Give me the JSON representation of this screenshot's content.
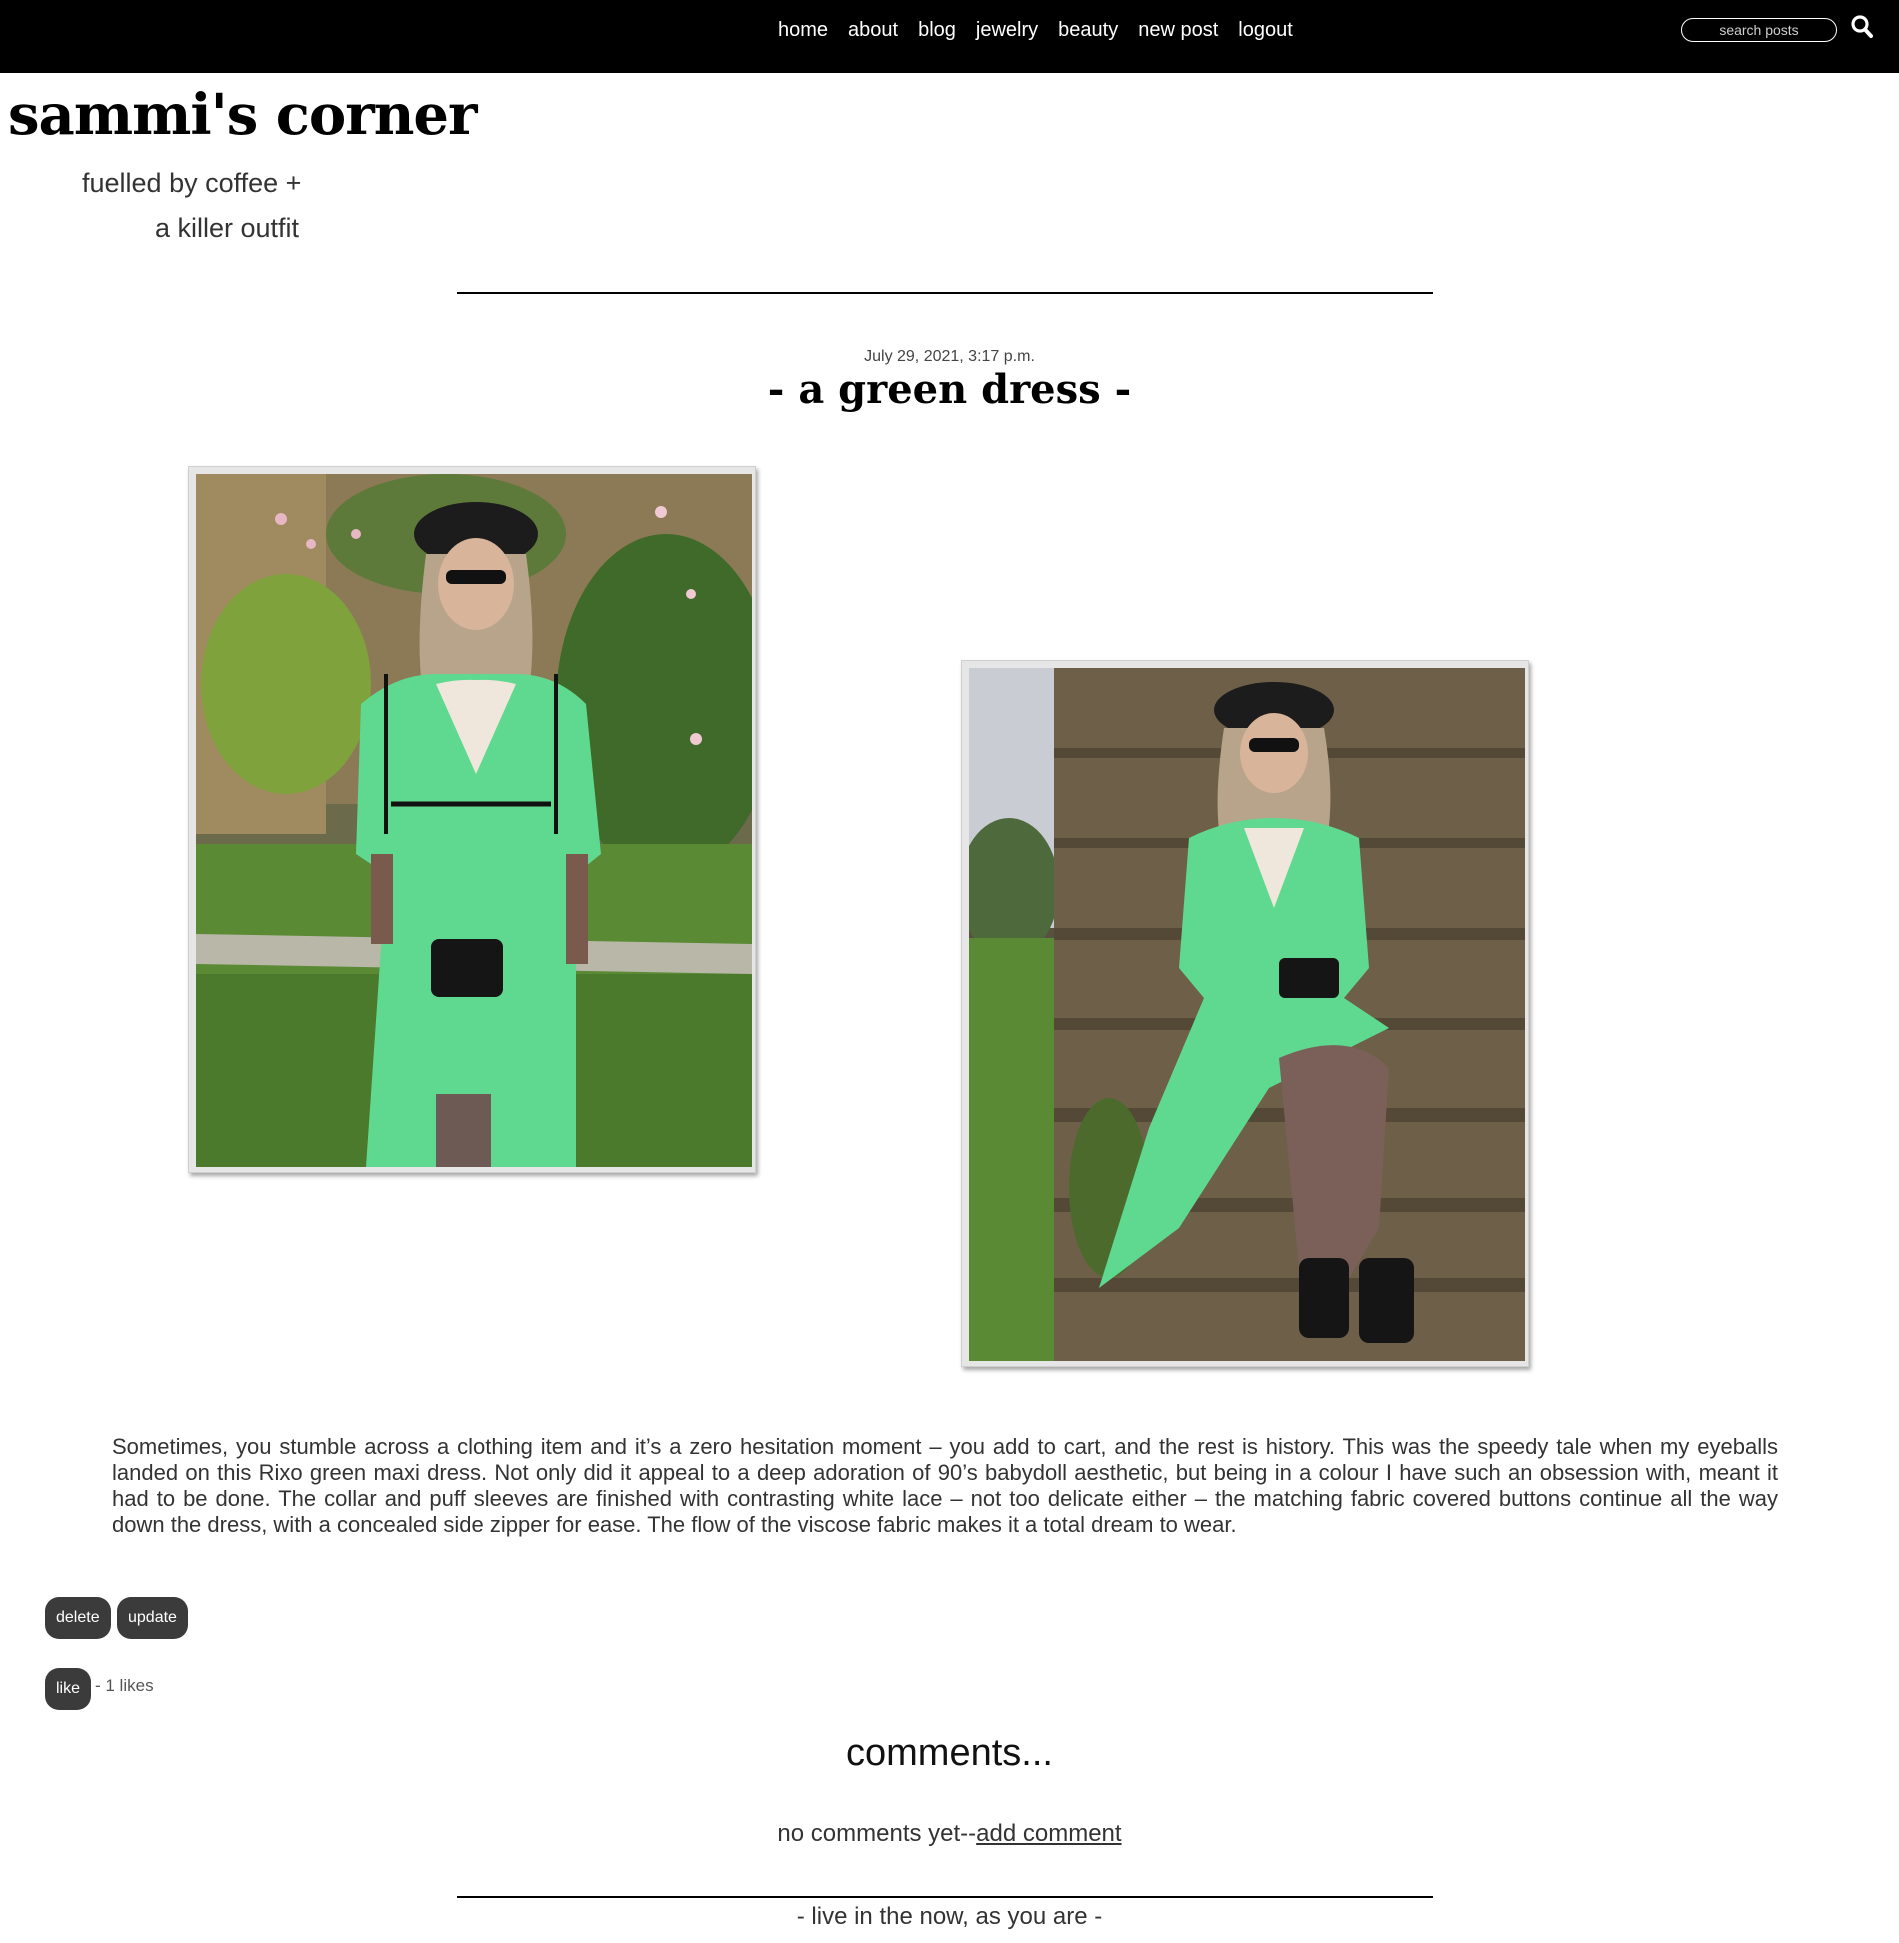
{
  "nav": {
    "links": [
      "home",
      "about",
      "blog",
      "jewelry",
      "beauty",
      "new post",
      "logout"
    ],
    "search_placeholder": "search posts",
    "search_icon": "search-icon"
  },
  "header": {
    "title": "sammi's corner",
    "tagline_line1": "fuelled by coffee +",
    "tagline_line2": "a killer outfit"
  },
  "post": {
    "date": "July 29, 2021, 3:17 p.m.",
    "title": "- a green dress -",
    "images": [
      {
        "name": "post-photo-standing",
        "depicts": "woman in green satin maxi dress standing on lawn"
      },
      {
        "name": "post-photo-sitting",
        "depicts": "woman in green satin maxi dress sitting on stone steps"
      }
    ],
    "body": "Sometimes, you stumble across a clothing item and it’s a zero hesitation moment – you add to cart, and the rest is history. This was the speedy tale when my eyeballs landed on this Rixo green maxi dress. Not only did it appeal to a deep adoration of 90’s babydoll aesthetic, but being in a colour I have such an obsession with, meant it had to be done. The collar and puff sleeves are finished with contrasting white lace – not too delicate either – the matching fabric covered buttons continue all the way down the dress, with a concealed side zipper for ease. The flow of the viscose fabric makes it a total dream to wear.",
    "delete_label": "delete",
    "update_label": "update",
    "like_label": "like",
    "likes_text": "- 1 likes"
  },
  "comments": {
    "heading": "comments...",
    "empty_text": "no comments yet--",
    "add_link": "add comment"
  },
  "footer": {
    "motto": "- live in the now, as you are -"
  },
  "colors": {
    "nav_bg": "#000000",
    "button_bg": "#3b3b3b",
    "dress_green": "#5fd98f"
  }
}
